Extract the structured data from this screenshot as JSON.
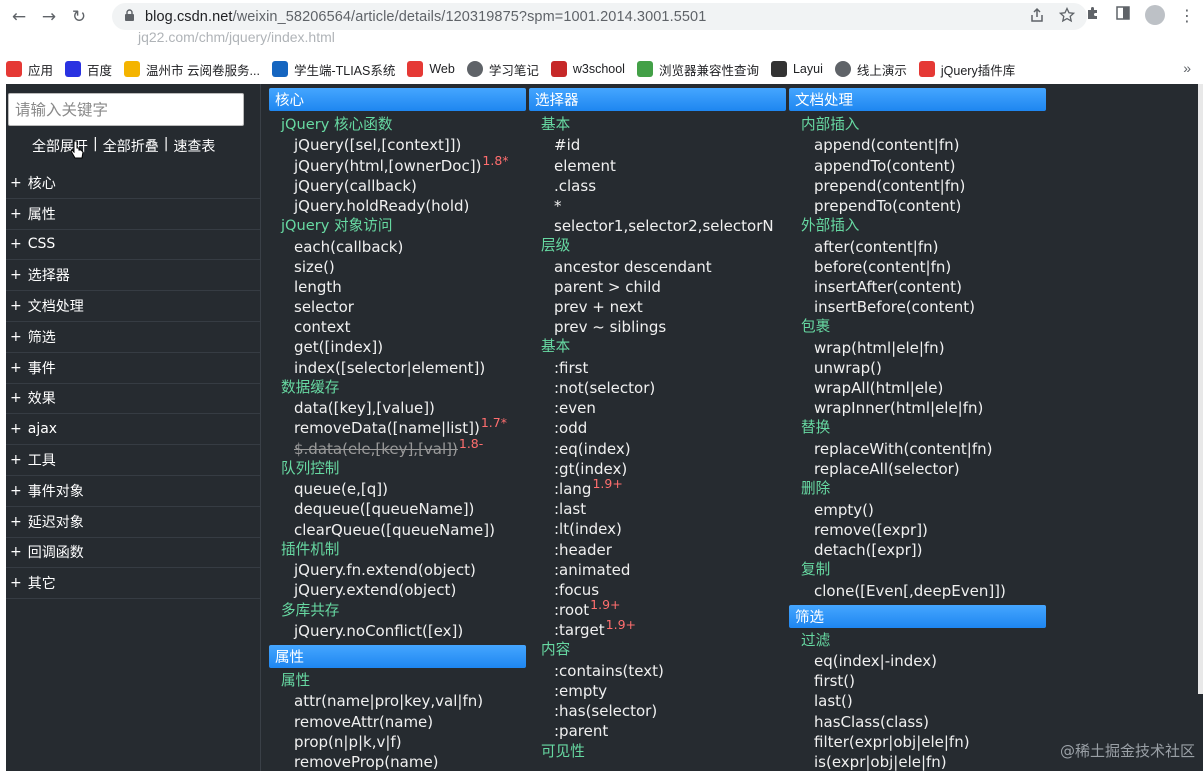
{
  "browser": {
    "url_host": "blog.csdn.net",
    "url_path": "/weixin_58206564/article/details/120319875?spm=1001.2014.3001.5501",
    "ghost_url": "jq22.com/chm/jquery/index.html"
  },
  "bookmarks": [
    {
      "label": "应用",
      "icon": "apps-grid-icon",
      "color": "#e53935"
    },
    {
      "label": "百度",
      "icon": "baidu-icon",
      "color": "#2932e1"
    },
    {
      "label": "温州市 云阅卷服务...",
      "icon": "cloud-icon",
      "color": "#f4b400"
    },
    {
      "label": "学生端-TLIAS系统",
      "icon": "tlias-icon",
      "color": "#1565c0"
    },
    {
      "label": "Web",
      "icon": "web-icon",
      "color": "#e53935"
    },
    {
      "label": "学习笔记",
      "icon": "globe-icon",
      "color": "#5f6368"
    },
    {
      "label": "w3school",
      "icon": "w3school-icon",
      "color": "#c62828"
    },
    {
      "label": "浏览器兼容性查询",
      "icon": "image-icon",
      "color": "#43a047"
    },
    {
      "label": "Layui",
      "icon": "layui-icon",
      "color": "#333333"
    },
    {
      "label": "线上演示",
      "icon": "globe-icon",
      "color": "#5f6368"
    },
    {
      "label": "jQuery插件库",
      "icon": "jquery-icon",
      "color": "#e53935"
    }
  ],
  "sidebar": {
    "search_placeholder": "请输入关键字",
    "link_expand": "全部展开",
    "link_collapse": "全部折叠",
    "link_quick": "速查表",
    "categories": [
      "核心",
      "属性",
      "CSS",
      "选择器",
      "文档处理",
      "筛选",
      "事件",
      "效果",
      "ajax",
      "工具",
      "事件对象",
      "延迟对象",
      "回调函数",
      "其它"
    ]
  },
  "columns": [
    {
      "header": "核心",
      "rows": [
        {
          "t": "g",
          "text": "jQuery 核心函数"
        },
        {
          "t": "i",
          "text": "jQuery([sel,[context]])"
        },
        {
          "t": "i",
          "text": "jQuery(html,[ownerDoc])",
          "ver": "1.8*"
        },
        {
          "t": "i",
          "text": "jQuery(callback)"
        },
        {
          "t": "i",
          "text": "jQuery.holdReady(hold)"
        },
        {
          "t": "g",
          "text": "jQuery 对象访问"
        },
        {
          "t": "i",
          "text": "each(callback)"
        },
        {
          "t": "i",
          "text": "size()"
        },
        {
          "t": "i",
          "text": "length"
        },
        {
          "t": "i",
          "text": "selector"
        },
        {
          "t": "i",
          "text": "context"
        },
        {
          "t": "i",
          "text": "get([index])"
        },
        {
          "t": "i",
          "text": "index([selector|element])"
        },
        {
          "t": "g",
          "text": "数据缓存"
        },
        {
          "t": "i",
          "text": "data([key],[value])"
        },
        {
          "t": "i",
          "text": "removeData([name|list])",
          "ver": "1.7*"
        },
        {
          "t": "s",
          "text": "$.data(ele,[key],[val])",
          "ver": "1.8-"
        },
        {
          "t": "g",
          "text": "队列控制"
        },
        {
          "t": "i",
          "text": "queue(e,[q])"
        },
        {
          "t": "i",
          "text": "dequeue([queueName])"
        },
        {
          "t": "i",
          "text": "clearQueue([queueName])"
        },
        {
          "t": "g",
          "text": "插件机制"
        },
        {
          "t": "i",
          "text": "jQuery.fn.extend(object)"
        },
        {
          "t": "i",
          "text": "jQuery.extend(object)"
        },
        {
          "t": "g",
          "text": "多库共存"
        },
        {
          "t": "i",
          "text": "jQuery.noConflict([ex])"
        },
        {
          "t": "h",
          "text": "属性"
        },
        {
          "t": "g",
          "text": "属性"
        },
        {
          "t": "i",
          "text": "attr(name|pro|key,val|fn)"
        },
        {
          "t": "i",
          "text": "removeAttr(name)"
        },
        {
          "t": "i",
          "text": "prop(n|p|k,v|f)"
        },
        {
          "t": "i",
          "text": "removeProp(name)"
        }
      ]
    },
    {
      "header": "选择器",
      "rows": [
        {
          "t": "g",
          "text": "基本"
        },
        {
          "t": "i",
          "text": "#id"
        },
        {
          "t": "i",
          "text": "element"
        },
        {
          "t": "i",
          "text": ".class"
        },
        {
          "t": "i",
          "text": "*"
        },
        {
          "t": "i",
          "text": "selector1,selector2,selectorN"
        },
        {
          "t": "g",
          "text": "层级"
        },
        {
          "t": "i",
          "text": "ancestor descendant"
        },
        {
          "t": "i",
          "text": "parent > child"
        },
        {
          "t": "i",
          "text": "prev + next"
        },
        {
          "t": "i",
          "text": "prev ~ siblings"
        },
        {
          "t": "g",
          "text": "基本"
        },
        {
          "t": "i",
          "text": ":first"
        },
        {
          "t": "i",
          "text": ":not(selector)"
        },
        {
          "t": "i",
          "text": ":even"
        },
        {
          "t": "i",
          "text": ":odd"
        },
        {
          "t": "i",
          "text": ":eq(index)"
        },
        {
          "t": "i",
          "text": ":gt(index)"
        },
        {
          "t": "i",
          "text": ":lang",
          "ver": "1.9+"
        },
        {
          "t": "i",
          "text": ":last"
        },
        {
          "t": "i",
          "text": ":lt(index)"
        },
        {
          "t": "i",
          "text": ":header"
        },
        {
          "t": "i",
          "text": ":animated"
        },
        {
          "t": "i",
          "text": ":focus"
        },
        {
          "t": "i",
          "text": ":root",
          "ver": "1.9+"
        },
        {
          "t": "i",
          "text": ":target",
          "ver": "1.9+"
        },
        {
          "t": "g",
          "text": "内容"
        },
        {
          "t": "i",
          "text": ":contains(text)"
        },
        {
          "t": "i",
          "text": ":empty"
        },
        {
          "t": "i",
          "text": ":has(selector)"
        },
        {
          "t": "i",
          "text": ":parent"
        },
        {
          "t": "g",
          "text": "可见性"
        }
      ]
    },
    {
      "header": "文档处理",
      "rows": [
        {
          "t": "g",
          "text": "内部插入"
        },
        {
          "t": "i",
          "text": "append(content|fn)"
        },
        {
          "t": "i",
          "text": "appendTo(content)"
        },
        {
          "t": "i",
          "text": "prepend(content|fn)"
        },
        {
          "t": "i",
          "text": "prependTo(content)"
        },
        {
          "t": "g",
          "text": "外部插入"
        },
        {
          "t": "i",
          "text": "after(content|fn)"
        },
        {
          "t": "i",
          "text": "before(content|fn)"
        },
        {
          "t": "i",
          "text": "insertAfter(content)"
        },
        {
          "t": "i",
          "text": "insertBefore(content)"
        },
        {
          "t": "g",
          "text": "包裹"
        },
        {
          "t": "i",
          "text": "wrap(html|ele|fn)"
        },
        {
          "t": "i",
          "text": "unwrap()"
        },
        {
          "t": "i",
          "text": "wrapAll(html|ele)"
        },
        {
          "t": "i",
          "text": "wrapInner(html|ele|fn)"
        },
        {
          "t": "g",
          "text": "替换"
        },
        {
          "t": "i",
          "text": "replaceWith(content|fn)"
        },
        {
          "t": "i",
          "text": "replaceAll(selector)"
        },
        {
          "t": "g",
          "text": "删除"
        },
        {
          "t": "i",
          "text": "empty()"
        },
        {
          "t": "i",
          "text": "remove([expr])"
        },
        {
          "t": "i",
          "text": "detach([expr])"
        },
        {
          "t": "g",
          "text": "复制"
        },
        {
          "t": "i",
          "text": "clone([Even[,deepEven]])"
        },
        {
          "t": "h",
          "text": "筛选"
        },
        {
          "t": "g",
          "text": "过滤"
        },
        {
          "t": "i",
          "text": "eq(index|-index)"
        },
        {
          "t": "i",
          "text": "first()"
        },
        {
          "t": "i",
          "text": "last()"
        },
        {
          "t": "i",
          "text": "hasClass(class)"
        },
        {
          "t": "i",
          "text": "filter(expr|obj|ele|fn)"
        },
        {
          "t": "i",
          "text": "is(expr|obj|ele|fn)"
        }
      ]
    }
  ],
  "watermark": "@稀土掘金技术社区",
  "colors": {
    "header": "#2b93f7",
    "group": "#67d9a2",
    "version": "#ff6e6e",
    "background": "#262b30"
  }
}
